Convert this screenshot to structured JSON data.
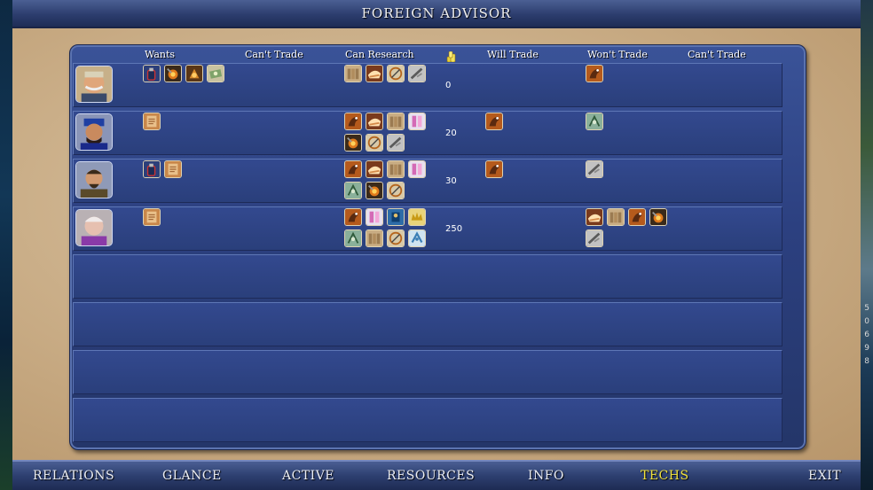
{
  "window": {
    "title": "FOREIGN ADVISOR"
  },
  "columns": {
    "wants": "Wants",
    "cant_trade_left": "Can't Trade",
    "can_research": "Can Research",
    "gold_icon": "gold-coins-icon",
    "will_trade": "Will Trade",
    "wont_trade": "Won't Trade",
    "cant_trade_right": "Can't Trade"
  },
  "rows": [
    {
      "leader": "leader-portrait-mustache-officer",
      "wants": [
        "gunpowder",
        "metallurgy",
        "bronze-working",
        "currency"
      ],
      "can_research": [
        [
          "masonry",
          "pottery",
          "navigation",
          "iron-working"
        ]
      ],
      "gold": "0",
      "will_trade": [],
      "wont_trade": [
        "horseback-riding"
      ]
    },
    {
      "leader": "leader-portrait-blue-hat",
      "wants": [
        "writing"
      ],
      "can_research": [
        [
          "horseback-riding",
          "pottery",
          "masonry",
          "mysticism"
        ],
        [
          "metallurgy",
          "navigation",
          "iron-working"
        ]
      ],
      "gold": "20",
      "will_trade": [
        "horseback-riding"
      ],
      "wont_trade": [
        "mathematics"
      ]
    },
    {
      "leader": "leader-portrait-bearded-noble",
      "wants": [
        "gunpowder",
        "writing"
      ],
      "can_research": [
        [
          "horseback-riding",
          "pottery",
          "masonry",
          "mysticism"
        ],
        [
          "mathematics",
          "metallurgy",
          "navigation"
        ]
      ],
      "gold": "30",
      "will_trade": [
        "horseback-riding"
      ],
      "wont_trade": [
        "iron-working"
      ]
    },
    {
      "leader": "leader-portrait-gray-elder",
      "wants": [
        "writing"
      ],
      "can_research": [
        [
          "horseback-riding",
          "mysticism",
          "philosophy",
          "monarchy"
        ],
        [
          "mathematics",
          "masonry",
          "navigation",
          "literacy"
        ]
      ],
      "gold": "250",
      "will_trade": [],
      "wont_trade": [
        "pottery",
        "masonry",
        "horseback-riding",
        "metallurgy",
        "iron-working"
      ]
    },
    {
      "empty": true
    },
    {
      "empty": true
    },
    {
      "empty": true
    },
    {
      "empty": true
    }
  ],
  "tabs": [
    {
      "label": "RELATIONS",
      "active": false
    },
    {
      "label": "GLANCE",
      "active": false
    },
    {
      "label": "ACTIVE",
      "active": false
    },
    {
      "label": "RESOURCES",
      "active": false
    },
    {
      "label": "INFO",
      "active": false
    },
    {
      "label": "TECHS",
      "active": true
    },
    {
      "label": "EXIT",
      "active": false
    }
  ],
  "map_edge_numbers": [
    "5",
    "0",
    "6",
    "9",
    "8"
  ],
  "colors": {
    "active_tab": "#f1e23c",
    "panel": "#2c4080",
    "parchment": "#c8ab84"
  }
}
